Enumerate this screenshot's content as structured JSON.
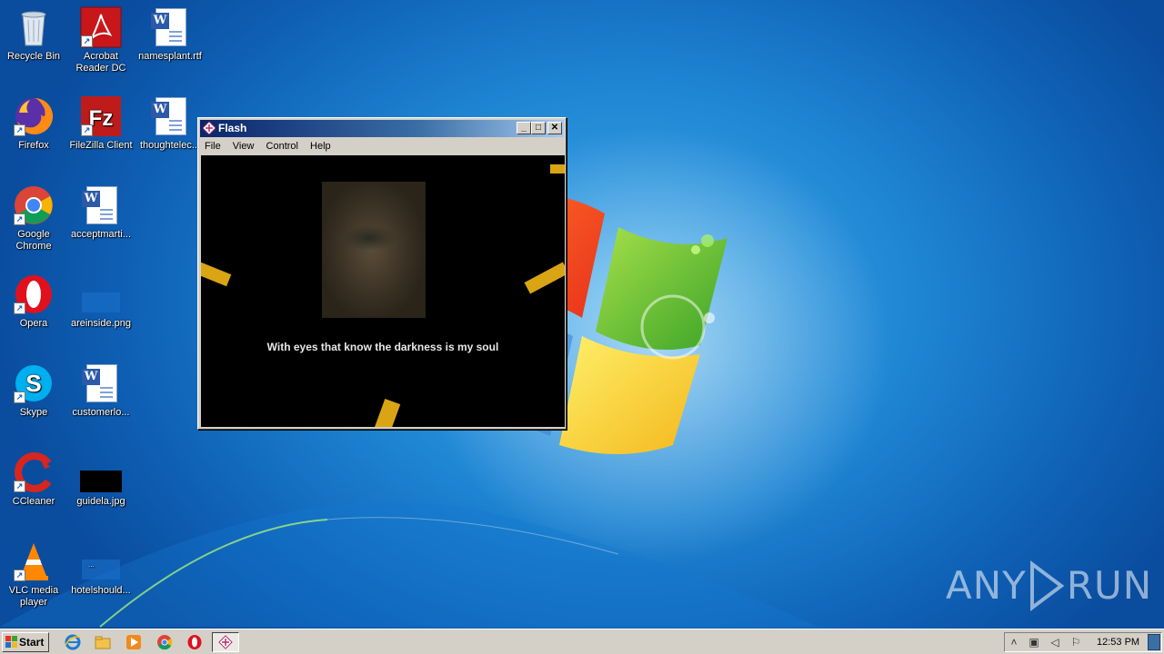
{
  "desktop": {
    "icons": [
      {
        "label": "Recycle Bin",
        "icon": "recycle-bin-icon"
      },
      {
        "label": "Acrobat Reader DC",
        "icon": "acrobat-icon"
      },
      {
        "label": "namesplant.rtf",
        "icon": "word-document-icon"
      },
      {
        "label": "Firefox",
        "icon": "firefox-icon"
      },
      {
        "label": "FileZilla Client",
        "icon": "filezilla-icon"
      },
      {
        "label": "thoughtelec...",
        "icon": "word-document-icon"
      },
      {
        "label": "Google Chrome",
        "icon": "chrome-icon"
      },
      {
        "label": "acceptmarti...",
        "icon": "word-document-icon"
      },
      {
        "label": "Opera",
        "icon": "opera-icon"
      },
      {
        "label": "areinside.png",
        "icon": "image-file-icon"
      },
      {
        "label": "Skype",
        "icon": "skype-icon"
      },
      {
        "label": "customerlo...",
        "icon": "word-document-icon"
      },
      {
        "label": "CCleaner",
        "icon": "ccleaner-icon"
      },
      {
        "label": "guidela.jpg",
        "icon": "image-file-icon"
      },
      {
        "label": "VLC media player",
        "icon": "vlc-icon"
      },
      {
        "label": "hotelshould...",
        "icon": "image-file-icon"
      }
    ]
  },
  "flash_window": {
    "title": "Flash",
    "menu": [
      "File",
      "View",
      "Control",
      "Help"
    ],
    "caption": "With eyes that know the darkness is my soul",
    "controls": {
      "minimize": "_",
      "maximize": "□",
      "close": "✕"
    },
    "accent_color": "#d9a514"
  },
  "watermark": {
    "left": "ANY",
    "right": "RUN"
  },
  "taskbar": {
    "start_label": "Start",
    "quick_launch": [
      "internet-explorer-icon",
      "explorer-folder-icon",
      "media-player-icon",
      "chrome-icon",
      "opera-icon"
    ],
    "tray": {
      "clock": "12:53 PM",
      "icons": [
        "chevron-up-icon",
        "network-icon",
        "volume-icon",
        "flag-icon"
      ]
    }
  }
}
